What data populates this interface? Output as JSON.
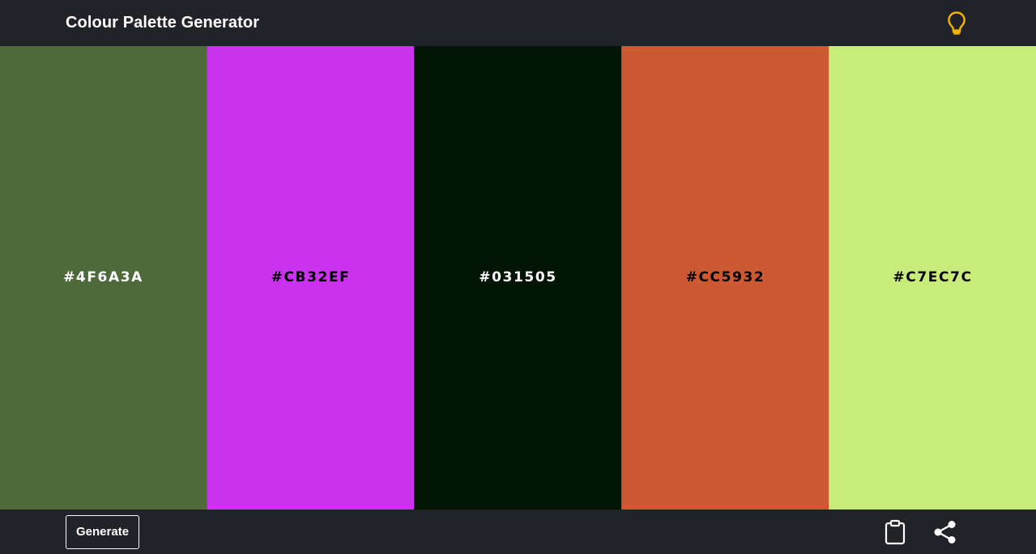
{
  "app": {
    "title": "Colour Palette Generator",
    "accent_color": "#F5B301",
    "bar_color": "#212328"
  },
  "header": {
    "hint_icon": "lightbulb-icon"
  },
  "palette": [
    {
      "hex": "#4F6A3A",
      "text_color": "#FFFFFF"
    },
    {
      "hex": "#CB32EF",
      "text_color": "#000000"
    },
    {
      "hex": "#031505",
      "text_color": "#FFFFFF"
    },
    {
      "hex": "#CC5932",
      "text_color": "#000000"
    },
    {
      "hex": "#C7EC7C",
      "text_color": "#000000"
    }
  ],
  "footer": {
    "generate_label": "Generate",
    "copy_icon": "clipboard-icon",
    "share_icon": "share-icon"
  }
}
